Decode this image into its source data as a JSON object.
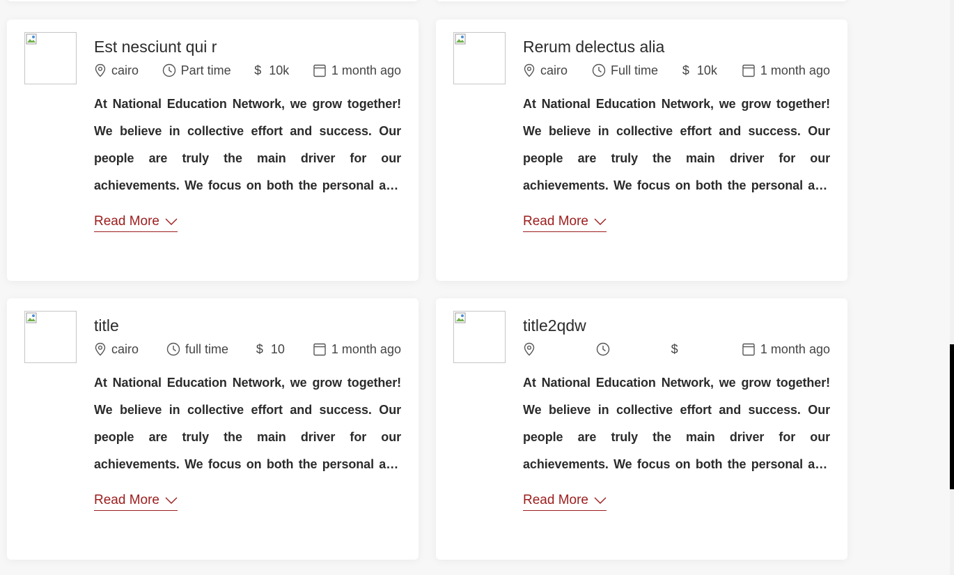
{
  "jobs": [
    {
      "title": "Est nesciunt qui r",
      "location": "cairo",
      "type": "Part time",
      "salary": "10k",
      "posted": "1 month ago",
      "description": "At National Education Network, we grow together! We believe in collective effort and success. Our people are truly the main driver for our achievements. We focus on both the personal and professional growth of our team members.",
      "read_more": "Read More"
    },
    {
      "title": "Rerum delectus alia",
      "location": "cairo",
      "type": "Full time",
      "salary": "10k",
      "posted": "1 month ago",
      "description": "At National Education Network, we grow together! We believe in collective effort and success. Our people are truly the main driver for our achievements. We focus on both the personal and professional growth of our team members.",
      "read_more": "Read More"
    },
    {
      "title": "title",
      "location": "cairo",
      "type": "full time",
      "salary": "10",
      "posted": "1 month ago",
      "description": "At National Education Network, we grow together! We believe in collective effort and success. Our people are truly the main driver for our achievements. We focus on both the personal and professional growth of our team members.",
      "read_more": "Read More"
    },
    {
      "title": "title2qdw",
      "location": "",
      "type": "",
      "salary": "",
      "posted": "1 month ago",
      "description": "At National Education Network, we grow together! We believe in collective effort and success. Our people are truly the main driver for our achievements. We focus on both the personal and professional growth of our team members.",
      "read_more": "Read More"
    }
  ],
  "icons": {
    "location": "map-pin-icon",
    "type": "clock-icon",
    "salary": "dollar-icon",
    "posted": "calendar-icon",
    "read_more": "chevron-down-icon"
  },
  "colors": {
    "accent": "#9c1c1c",
    "card_bg": "#ffffff",
    "page_bg": "#f7f7f7"
  }
}
